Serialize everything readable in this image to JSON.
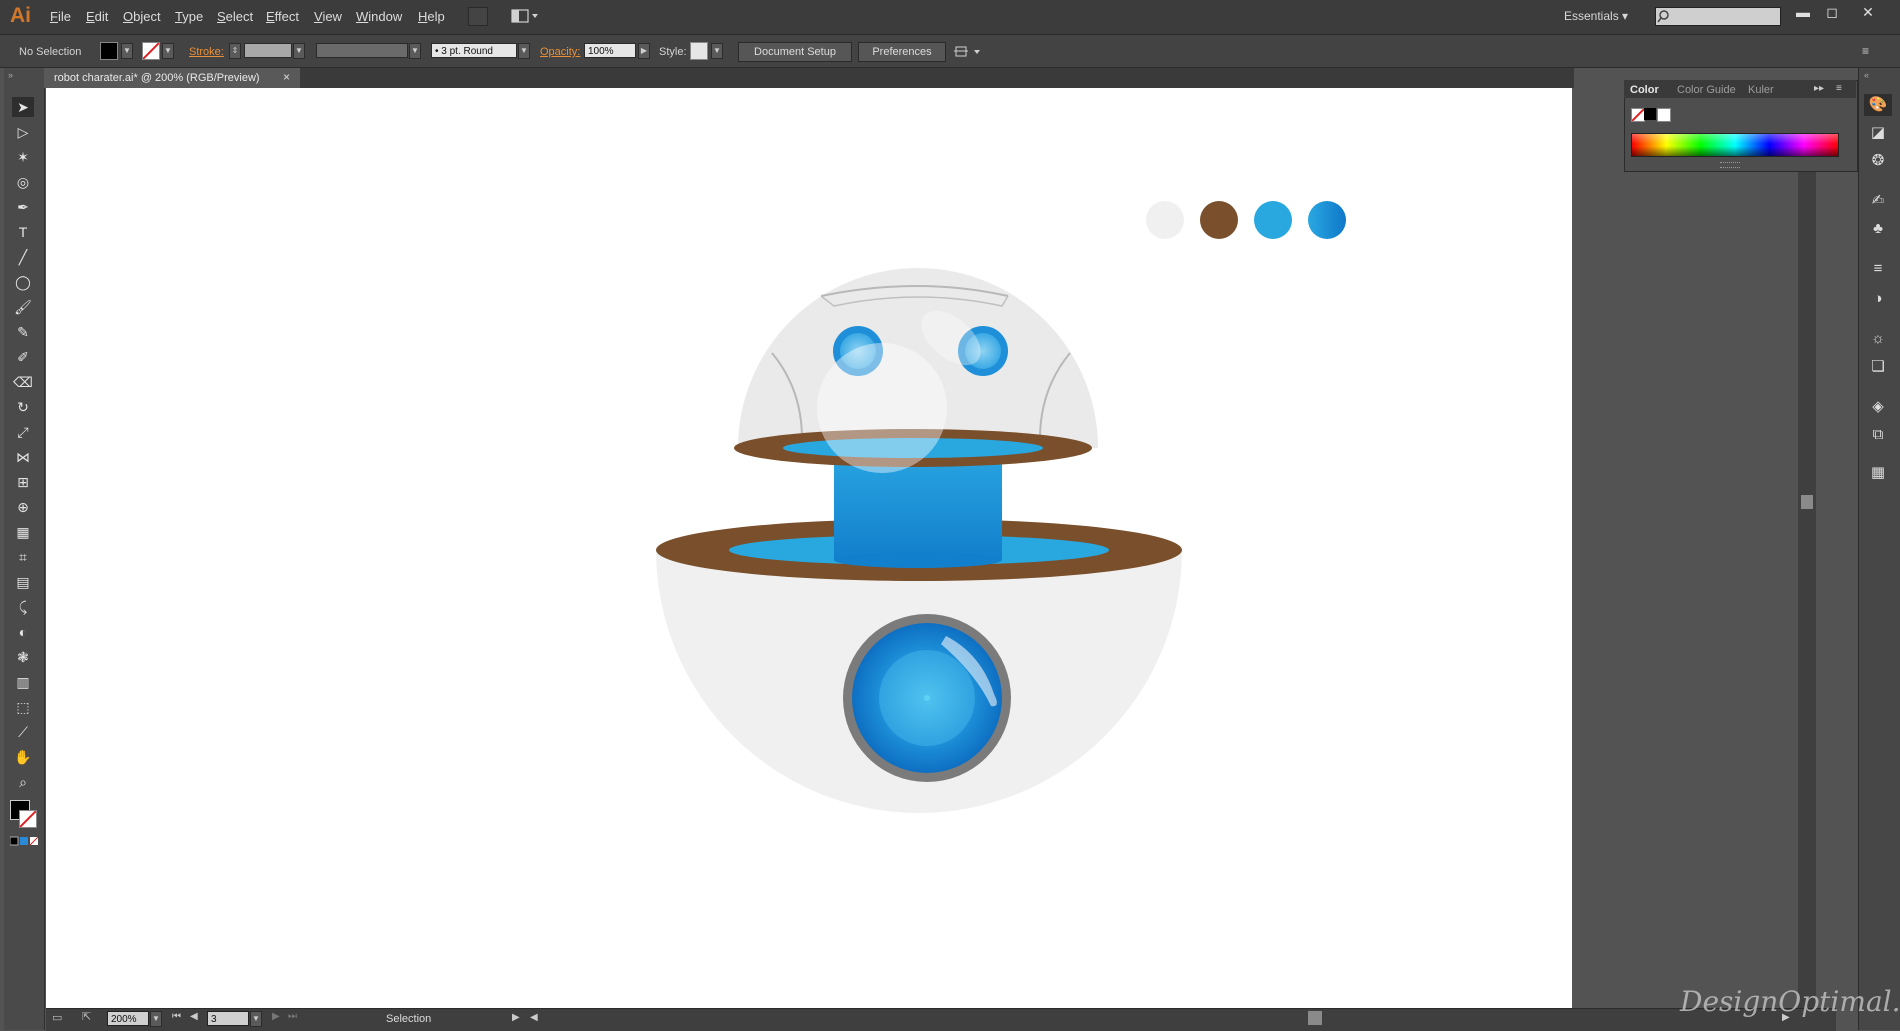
{
  "app": {
    "logo": "Ai"
  },
  "menu": [
    "File",
    "Edit",
    "Object",
    "Type",
    "Select",
    "Effect",
    "View",
    "Window",
    "Help"
  ],
  "workspace": "Essentials",
  "control_bar": {
    "selection": "No Selection",
    "stroke_label": "Stroke:",
    "brush": "3 pt. Round",
    "opacity_label": "Opacity:",
    "opacity_value": "100%",
    "style_label": "Style:",
    "document_setup": "Document Setup",
    "preferences": "Preferences"
  },
  "document_tab": {
    "title": "robot charater.ai* @ 200% (RGB/Preview)",
    "close": "×"
  },
  "color_panel": {
    "tabs": [
      "Color",
      "Color Guide",
      "Kuler"
    ]
  },
  "status_bar": {
    "zoom": "200%",
    "artboard": "3",
    "tool": "Selection"
  },
  "artwork": {
    "swatches": [
      "#f0f0f0",
      "#7a4f2b",
      "#29a8e0",
      "#1a8ad6"
    ]
  },
  "watermark": "DesignOptimal.com",
  "icons": {
    "tools": [
      "selection-icon",
      "direct-selection-icon",
      "magic-wand-icon",
      "lasso-icon",
      "pen-icon",
      "type-icon",
      "line-icon",
      "ellipse-icon",
      "paintbrush-icon",
      "pencil-icon",
      "blob-brush-icon",
      "eraser-icon",
      "rotate-icon",
      "scale-icon",
      "width-icon",
      "free-transform-icon",
      "shape-builder-icon",
      "perspective-grid-icon",
      "mesh-icon",
      "gradient-icon",
      "eyedropper-icon",
      "blend-icon",
      "symbol-sprayer-icon",
      "column-graph-icon",
      "artboard-icon",
      "slice-icon",
      "hand-icon",
      "zoom-icon"
    ],
    "dock": [
      "color-icon",
      "gradient-panel-icon",
      "color-guide-icon",
      "brushes-icon",
      "symbols-icon",
      "stroke-icon",
      "transparency-icon",
      "appearance-icon",
      "graphic-styles-icon",
      "layers-icon",
      "artboards-panel-icon",
      "swatches-icon"
    ]
  }
}
